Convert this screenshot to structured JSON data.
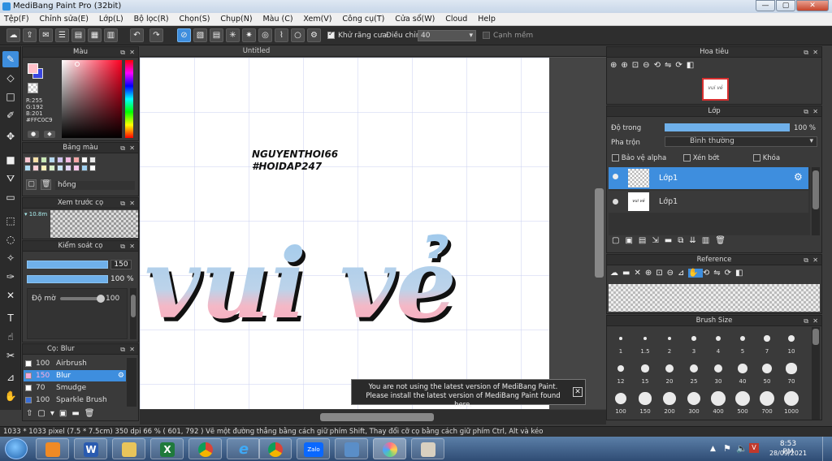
{
  "window": {
    "title": "MediBang Paint Pro (32bit)",
    "minimize": "—",
    "maximize": "▢",
    "close": "✕"
  },
  "menu": [
    "Tệp(F)",
    "Chỉnh sửa(E)",
    "Lớp(L)",
    "Bộ lọc(R)",
    "Chọn(S)",
    "Chụp(N)",
    "Màu (C)",
    "Xem(V)",
    "Công cụ(T)",
    "Cửa sổ(W)",
    "Cloud",
    "Help"
  ],
  "toolbar": {
    "antialias_label": "Khử răng cưa",
    "adjust_label": "Điều chỉnh",
    "adjust_value": "40",
    "snap_label": "Cạnh mềm"
  },
  "color_panel": {
    "title": "Màu",
    "r": "R:255",
    "g": "G:192",
    "b": "B:201",
    "hex": "#FFC0C9",
    "primary_color": "#FFC0C9"
  },
  "palette_panel": {
    "title": "Bảng màu",
    "name": "hồng",
    "swatches": [
      "#f6c5cf",
      "#f7e0a8",
      "#c9e8b5",
      "#b5d8ef",
      "#cfc4ef",
      "#f2b9e1",
      "#f5a8a8",
      "#ffffff",
      "#e8e8e8",
      "#aeddf5",
      "#ffcfd6",
      "#fff1b8",
      "#d8f0c8",
      "#c7e4f7",
      "#e2d5f5",
      "#f7c7ea",
      "#9fd0f0",
      "#ffffff"
    ]
  },
  "brush_preview_panel": {
    "title": "Xem trước cọ",
    "size": "10.8m"
  },
  "brush_control_panel": {
    "title": "Kiểm soát cọ",
    "size_value": "150",
    "opacity_value": "100 %",
    "opacity_label": "Độ mờ",
    "opacity2_value": "100"
  },
  "brush_list_panel": {
    "title": "Cọ: Blur",
    "items": [
      {
        "size": "100",
        "name": "Airbrush",
        "color": "#ffffff"
      },
      {
        "size": "150",
        "name": "Blur",
        "color": "#f5a8d8"
      },
      {
        "size": "70",
        "name": "Smudge",
        "color": "#ffffff"
      },
      {
        "size": "100",
        "name": "Sparkle Brush",
        "color": "#3a6fd8"
      }
    ]
  },
  "document": {
    "tab_title": "Untitled",
    "handwriting_line1": "NGUYENTHOI66",
    "handwriting_line2": "#HOIDAP247",
    "art_text": "vui vẻ"
  },
  "notification": {
    "line1": "You are not using the latest version of MediBang Paint.",
    "line2": "Please install the latest version of MediBang Paint found here."
  },
  "navigator_panel": {
    "title": "Hoa tiêu",
    "thumb_text": "vui vẻ"
  },
  "layer_panel": {
    "title": "Lớp",
    "opacity_label": "Độ trong",
    "opacity_value": "100 %",
    "opacity_fraction": 1.0,
    "blend_label": "Pha trộn",
    "blend_value": "Bình thường",
    "protect_alpha": "Bảo vệ alpha",
    "clipping": "Xén bớt",
    "lock": "Khóa",
    "layers": [
      {
        "name": "Lớp1",
        "selected": true
      },
      {
        "name": "Lớp1",
        "selected": false
      }
    ]
  },
  "reference_panel": {
    "title": "Reference"
  },
  "brush_size_panel": {
    "title": "Brush Size",
    "sizes": [
      "1",
      "1.5",
      "2",
      "3",
      "4",
      "5",
      "7",
      "10",
      "12",
      "15",
      "20",
      "25",
      "30",
      "40",
      "50",
      "70",
      "100",
      "150",
      "200",
      "300",
      "400",
      "500",
      "700",
      "1000"
    ]
  },
  "status": {
    "text": "1033 * 1033 pixel  (7.5 * 7.5cm)  350 dpi  66 %  ( 601, 792 )  Vẽ một đường thẳng bằng cách giữ phím Shift, Thay đổi cỡ cọ bằng cách giữ phím Ctrl, Alt và kéo"
  },
  "taskbar": {
    "time": "8:53 PM",
    "date": "28/09/2021",
    "zalo_label": "Zalo"
  }
}
